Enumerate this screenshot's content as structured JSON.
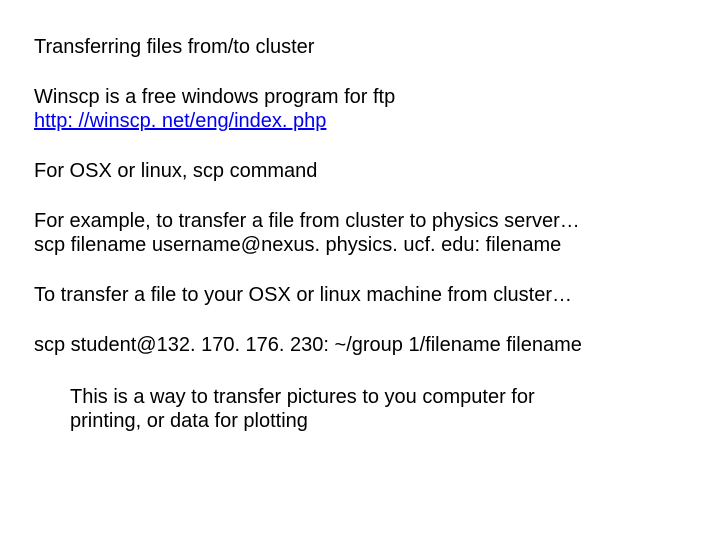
{
  "title": "Transferring files from/to cluster",
  "p1_line1": "Winscp is a free windows program for ftp",
  "link_text": "http: //winscp. net/eng/index. php",
  "p2": "For OSX or linux, scp command",
  "p3_line1": "For example, to transfer a file from cluster to physics server…",
  "p3_line2": "scp filename username@nexus. physics. ucf. edu: filename",
  "p4": "To transfer a file to your OSX or linux machine from cluster…",
  "p5": "scp student@132. 170. 176. 230: ~/group 1/filename filename",
  "p6_line1": "This is a way to transfer pictures to you computer for",
  "p6_line2": "printing, or data for plotting"
}
